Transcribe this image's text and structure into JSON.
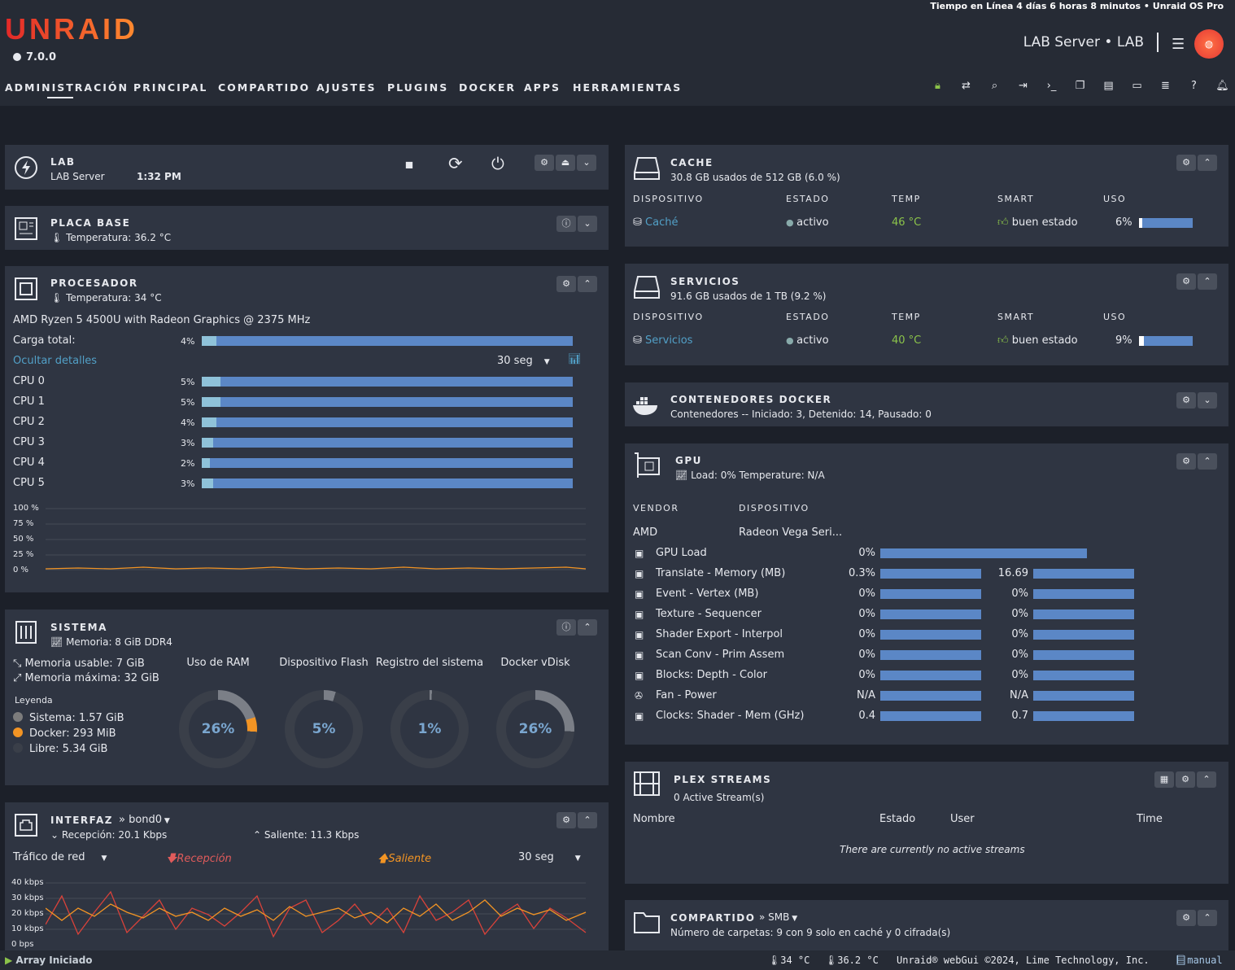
{
  "header": {
    "uptime": "Tiempo en Línea 4 días 6 horas 8 minutos  •  Unraid OS Pro",
    "logo": "UNRAID",
    "version": "7.0.0",
    "server": "LAB Server • LAB"
  },
  "nav": {
    "items": [
      "ADMINISTRACIÓN",
      "PRINCIPAL",
      "COMPARTIDO",
      "AJUSTES",
      "PLUGINS",
      "DOCKER",
      "APPS",
      "HERRAMIENTAS"
    ]
  },
  "lab": {
    "title": "LAB",
    "sub": "LAB Server",
    "time": "1:32 PM"
  },
  "placa": {
    "title": "PLACA BASE",
    "temp": "Temperatura: 36.2 °C"
  },
  "cpu": {
    "title": "PROCESADOR",
    "temp": "Temperatura: 34 °C",
    "model": "AMD Ryzen 5 4500U with Radeon Graphics @ 2375 MHz",
    "load_label": "Carga total:",
    "load": "4%",
    "load_frac": 0.04,
    "hide": "Ocultar detalles",
    "interval": "30 seg",
    "cores": [
      {
        "name": "CPU 0",
        "val": "5%",
        "f": 0.05
      },
      {
        "name": "CPU 1",
        "val": "5%",
        "f": 0.05
      },
      {
        "name": "CPU 2",
        "val": "4%",
        "f": 0.04
      },
      {
        "name": "CPU 3",
        "val": "3%",
        "f": 0.03
      },
      {
        "name": "CPU 4",
        "val": "2%",
        "f": 0.02
      },
      {
        "name": "CPU 5",
        "val": "3%",
        "f": 0.03
      }
    ],
    "yticks": [
      "100 %",
      "75 %",
      "50 %",
      "25 %",
      "0 %"
    ]
  },
  "sistema": {
    "title": "SISTEMA",
    "mem": "Memoria: 8 GiB DDR4",
    "usable": "Memoria usable: 7 GiB",
    "max": "Memoria máxima: 32 GiB",
    "legend": "Leyenda",
    "sys": "Sistema: 1.57 GiB",
    "docker": "Docker: 293 MiB",
    "free": "Libre: 5.34 GiB",
    "donuts": [
      {
        "label": "Uso de RAM",
        "val": "26%",
        "f": 0.26
      },
      {
        "label": "Dispositivo Flash",
        "val": "5%",
        "f": 0.05
      },
      {
        "label": "Registro del sistema",
        "val": "1%",
        "f": 0.01
      },
      {
        "label": "Docker vDisk",
        "val": "26%",
        "f": 0.26
      }
    ]
  },
  "interfaz": {
    "title": "INTERFAZ",
    "iface": "bond0",
    "rx": "Recepción: 20.1 Kbps",
    "tx": "Saliente: 11.3 Kbps",
    "traffic": "Tráfico de red",
    "rxl": "Recepción",
    "txl": "Saliente",
    "interval": "30 seg",
    "yticks": [
      "40 kbps",
      "30 kbps",
      "20 kbps",
      "10 kbps",
      "0 bps"
    ]
  },
  "cache": {
    "title": "CACHE",
    "used": "30.8 GB usados de 512 GB (6.0 %)",
    "h": [
      "DISPOSITIVO",
      "ESTADO",
      "TEMP",
      "SMART",
      "USO"
    ],
    "dev": "Caché",
    "state": "activo",
    "temp": "46 °C",
    "smart": "buen estado",
    "use": "6%",
    "f": 0.06
  },
  "servicios": {
    "title": "SERVICIOS",
    "used": "91.6 GB usados de 1 TB (9.2 %)",
    "h": [
      "DISPOSITIVO",
      "ESTADO",
      "TEMP",
      "SMART",
      "USO"
    ],
    "dev": "Servicios",
    "state": "activo",
    "temp": "40 °C",
    "smart": "buen estado",
    "use": "9%",
    "f": 0.09
  },
  "docker": {
    "title": "CONTENEDORES DOCKER",
    "sub": "Contenedores -- Iniciado: 3, Detenido: 14, Pausado: 0"
  },
  "gpu": {
    "title": "GPU",
    "sub": "Load: 0% Temperature: N/A",
    "h1": "VENDOR",
    "h2": "DISPOSITIVO",
    "vendor": "AMD",
    "device": "Radeon Vega Seri...",
    "rows": [
      {
        "name": "GPU Load",
        "v1": "0%",
        "v2": ""
      },
      {
        "name": "Translate - Memory (MB)",
        "v1": "0.3%",
        "v2": "16.69"
      },
      {
        "name": "Event - Vertex (MB)",
        "v1": "0%",
        "v2": "0%"
      },
      {
        "name": "Texture - Sequencer",
        "v1": "0%",
        "v2": "0%"
      },
      {
        "name": "Shader Export - Interpol",
        "v1": "0%",
        "v2": "0%"
      },
      {
        "name": "Scan Conv - Prim Assem",
        "v1": "0%",
        "v2": "0%"
      },
      {
        "name": "Blocks: Depth - Color",
        "v1": "0%",
        "v2": "0%"
      },
      {
        "name": "Fan - Power",
        "v1": "N/A",
        "v2": "N/A"
      },
      {
        "name": "Clocks: Shader - Mem (GHz)",
        "v1": "0.4",
        "v2": "0.7"
      }
    ]
  },
  "plex": {
    "title": "PLEX STREAMS",
    "sub": "0 Active Stream(s)",
    "h": [
      "Nombre",
      "Estado",
      "User",
      "Time"
    ],
    "empty": "There are currently no active streams"
  },
  "compartido": {
    "title": "COMPARTIDO",
    "proto": "SMB",
    "sub": "Número de carpetas: 9 con 9 solo en caché y 0 cifrada(s)"
  },
  "footer": {
    "status": "Array Iniciado",
    "t1": "34 °C",
    "t2": "36.2 °C",
    "copy": "Unraid® webGui ©2024, Lime Technology, Inc.",
    "manual": "manual"
  }
}
